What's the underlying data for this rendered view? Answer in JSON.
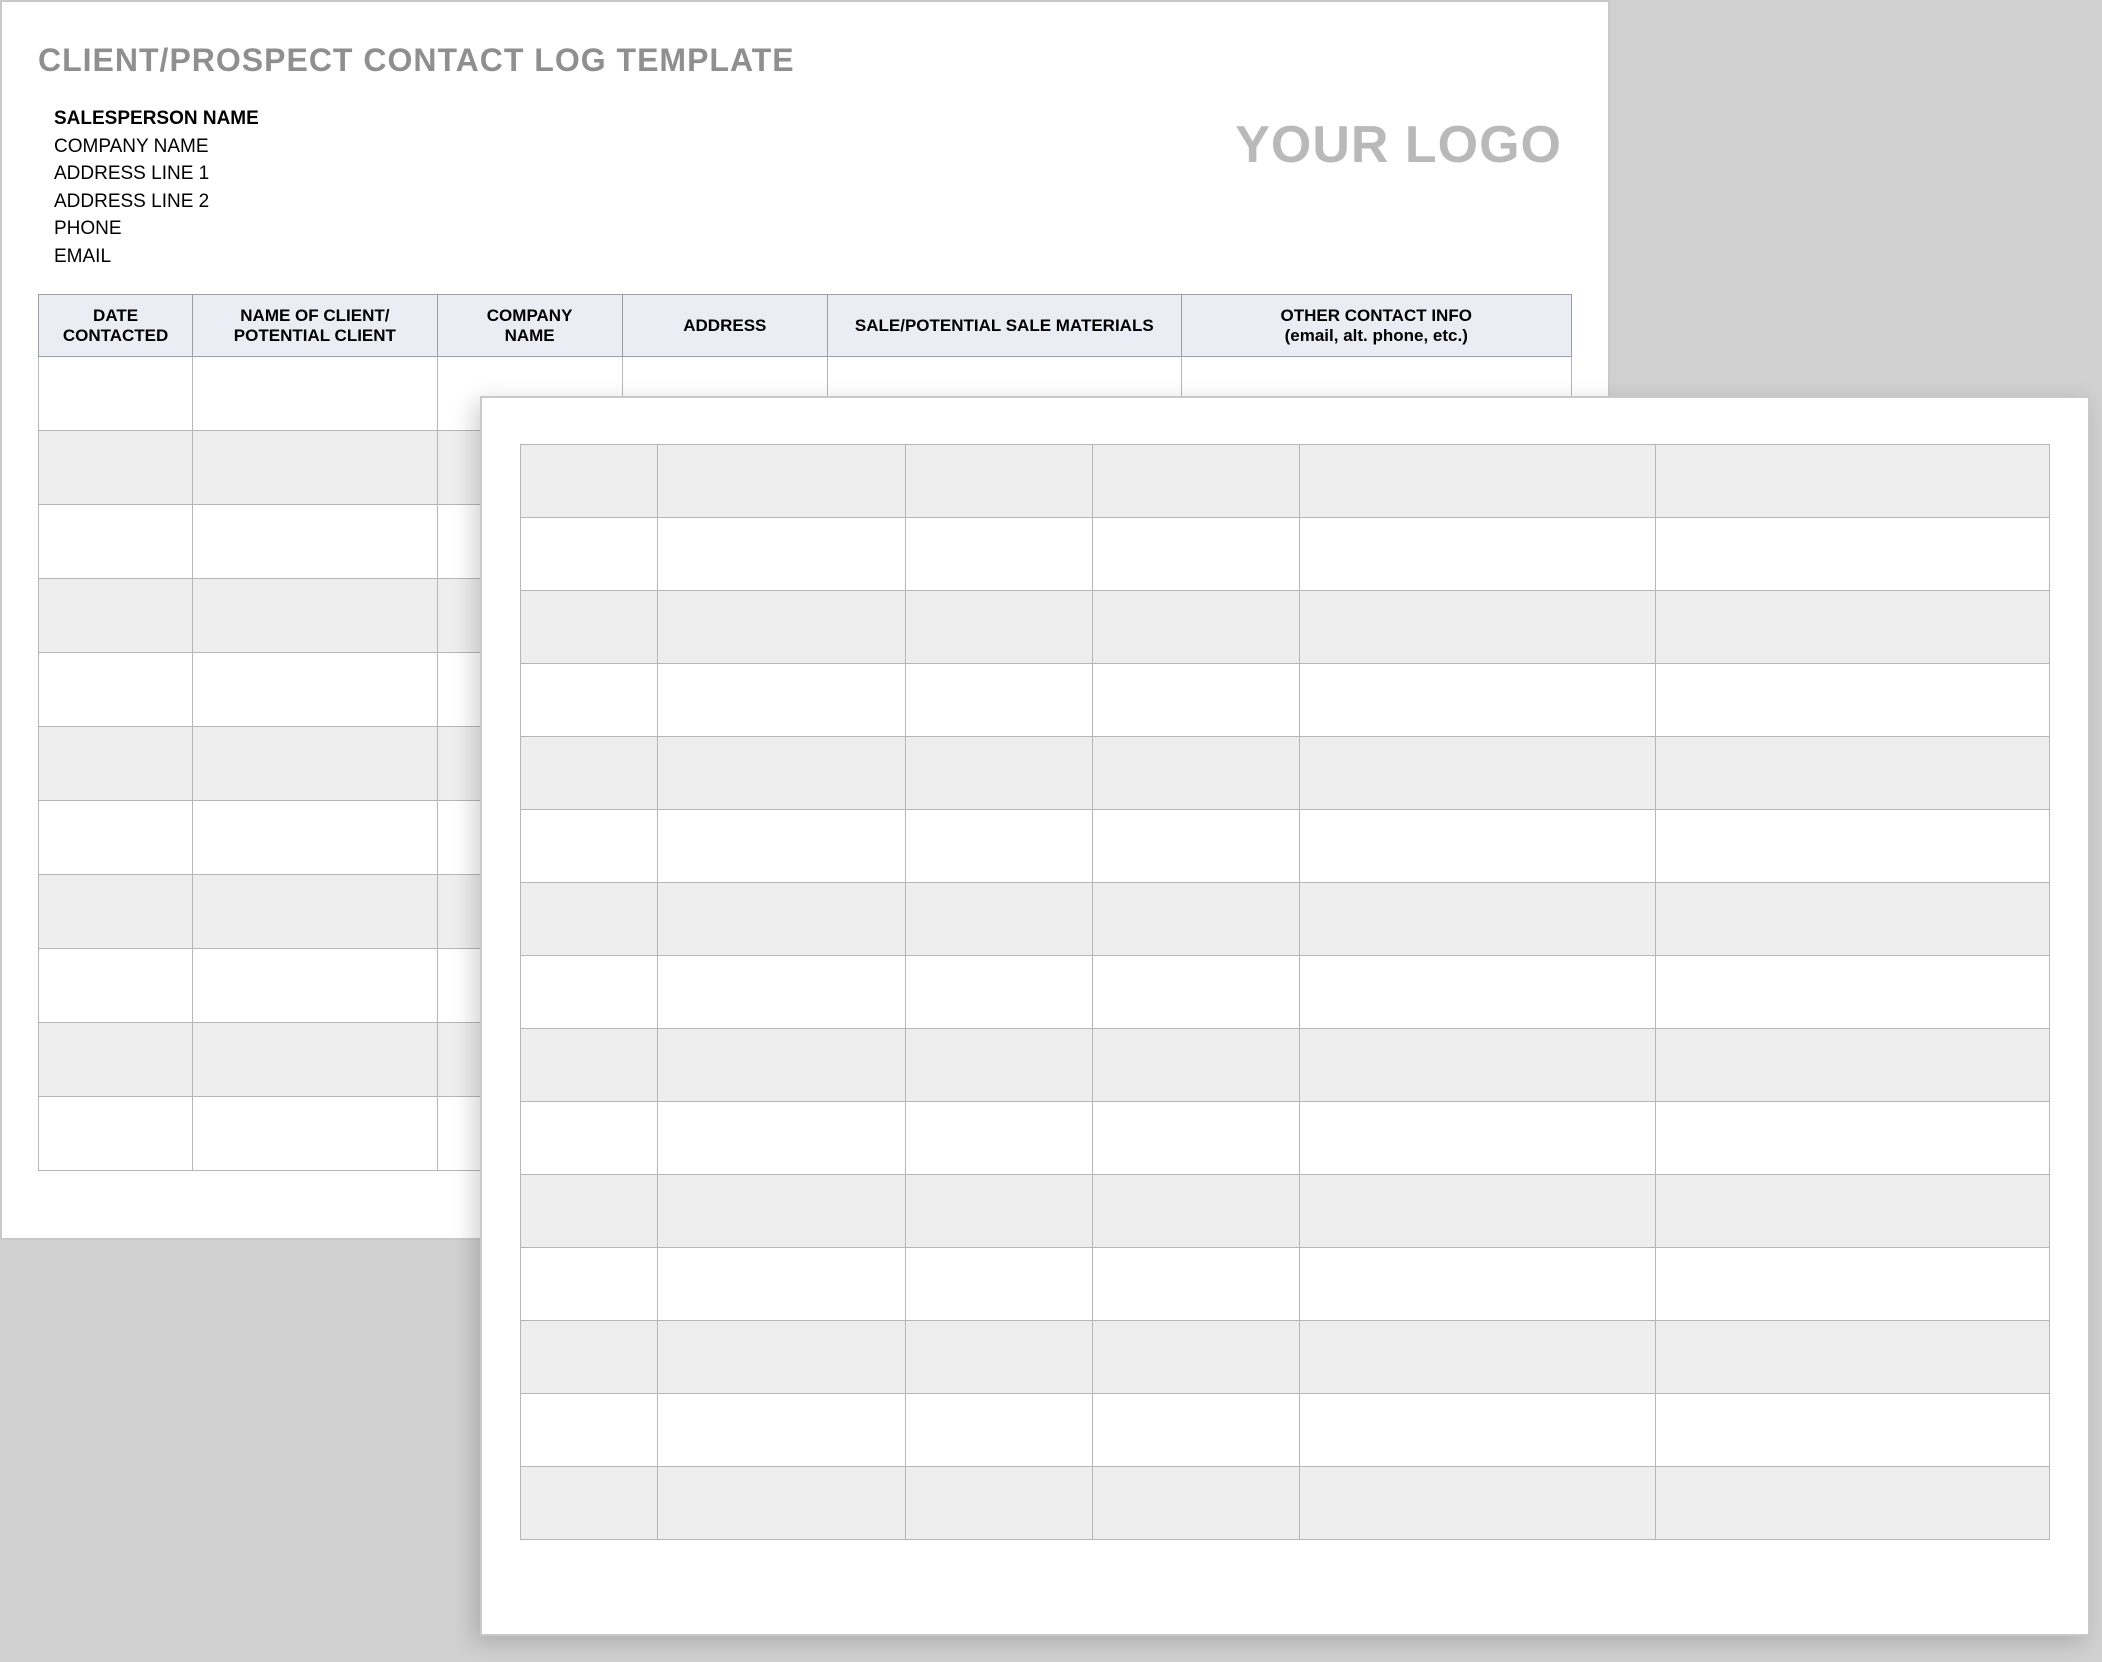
{
  "page1": {
    "title": "CLIENT/PROSPECT CONTACT LOG TEMPLATE",
    "info": {
      "salesperson_label": "SALESPERSON NAME",
      "company": "COMPANY NAME",
      "address1": "ADDRESS LINE 1",
      "address2": "ADDRESS LINE 2",
      "phone": "PHONE",
      "email": "EMAIL"
    },
    "logo_text": "YOUR LOGO",
    "columns": {
      "c1a": "DATE",
      "c1b": "CONTACTED",
      "c2a": "NAME OF CLIENT/",
      "c2b": "POTENTIAL CLIENT",
      "c3a": "COMPANY",
      "c3b": "NAME",
      "c4": "ADDRESS",
      "c5": "SALE/POTENTIAL SALE MATERIALS",
      "c6a": "OTHER CONTACT INFO",
      "c6b": "(email, alt. phone, etc.)"
    }
  }
}
